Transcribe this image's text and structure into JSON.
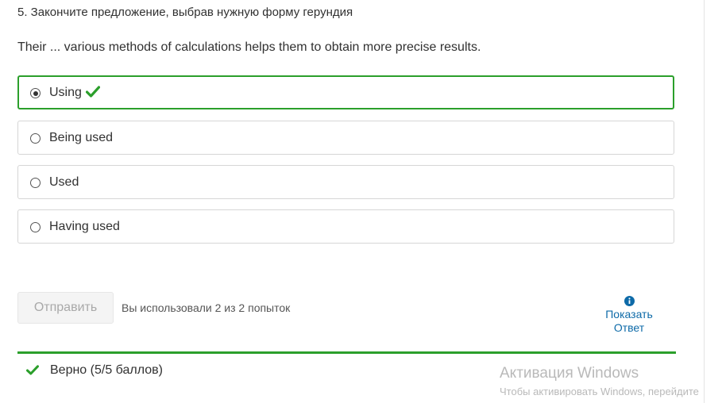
{
  "question": {
    "title": "5. Закончите предложение, выбрав нужную форму герундия",
    "text": "Their ... various methods of calculations helps them to obtain more precise results."
  },
  "options": [
    {
      "label": "Using",
      "selected": true,
      "correct": true
    },
    {
      "label": "Being used",
      "selected": false,
      "correct": false
    },
    {
      "label": "Used",
      "selected": false,
      "correct": false
    },
    {
      "label": "Having used",
      "selected": false,
      "correct": false
    }
  ],
  "actions": {
    "submit_label": "Отправить",
    "attempts_text": "Вы использовали 2 из 2 попыток",
    "show_answer_line1": "Показать",
    "show_answer_line2": "Ответ"
  },
  "feedback": {
    "text": "Верно (5/5 баллов)"
  },
  "watermark": {
    "title": "Активация Windows",
    "subtitle": "Чтобы активировать Windows, перейдите"
  },
  "colors": {
    "correct_green": "#2b9f2b",
    "link_blue": "#0d6aa8",
    "text": "#313131",
    "border": "#d6d6d6"
  },
  "icons": {
    "correct": "check-icon",
    "info": "info-icon"
  }
}
